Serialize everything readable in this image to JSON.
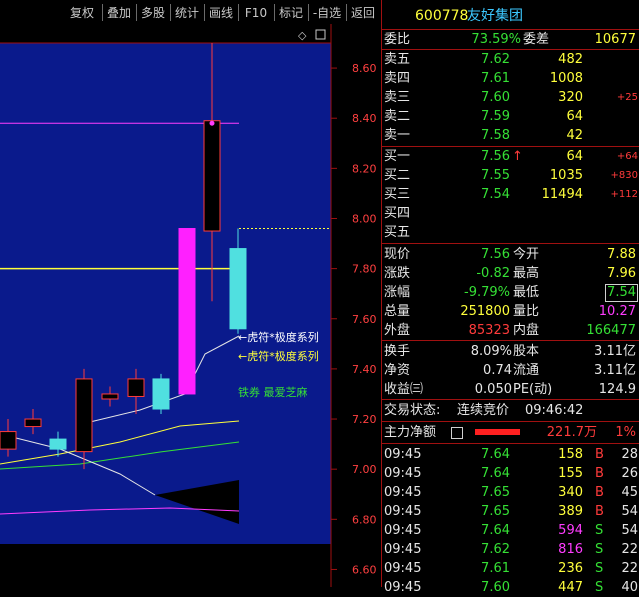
{
  "toolbar": {
    "items": [
      "复权",
      "叠加",
      "多股",
      "统计",
      "画线",
      "F10",
      "标记",
      "-自选",
      "返回"
    ]
  },
  "header": {
    "code": "600778",
    "name": "友好集团"
  },
  "weibi": {
    "label": "委比",
    "value": "73.59%",
    "diff_label": "委差",
    "diff_value": "10677"
  },
  "sell": [
    {
      "label": "卖五",
      "price": "7.62",
      "vol": "482",
      "chg": ""
    },
    {
      "label": "卖四",
      "price": "7.61",
      "vol": "1008",
      "chg": ""
    },
    {
      "label": "卖三",
      "price": "7.60",
      "vol": "320",
      "chg": "+25"
    },
    {
      "label": "卖二",
      "price": "7.59",
      "vol": "64",
      "chg": ""
    },
    {
      "label": "卖一",
      "price": "7.58",
      "vol": "42",
      "chg": ""
    }
  ],
  "buy": [
    {
      "label": "买一",
      "price": "7.56",
      "vol": "64",
      "chg": "+64",
      "arrow": "↑"
    },
    {
      "label": "买二",
      "price": "7.55",
      "vol": "1035",
      "chg": "+830",
      "arrow": ""
    },
    {
      "label": "买三",
      "price": "7.54",
      "vol": "11494",
      "chg": "+112",
      "arrow": ""
    },
    {
      "label": "买四",
      "price": "",
      "vol": "",
      "chg": "",
      "arrow": ""
    },
    {
      "label": "买五",
      "price": "",
      "vol": "",
      "chg": "",
      "arrow": ""
    }
  ],
  "quote": {
    "xianjia_label": "现价",
    "xianjia": "7.56",
    "jinkai_label": "今开",
    "jinkai": "7.88",
    "zhangdie_label": "涨跌",
    "zhangdie": "-0.82",
    "zuigao_label": "最高",
    "zuigao": "7.96",
    "zhangfu_label": "涨幅",
    "zhangfu": "-9.79%",
    "zuidi_label": "最低",
    "zuidi": "7.54",
    "zongliang_label": "总量",
    "zongliang": "251800",
    "liangbi_label": "量比",
    "liangbi": "10.27",
    "waipan_label": "外盘",
    "waipan": "85323",
    "neipan_label": "内盘",
    "neipan": "166477"
  },
  "stats": {
    "huanshou_label": "换手",
    "huanshou": "8.09%",
    "guben_label": "股本",
    "guben": "3.11亿",
    "jingzi_label": "净资",
    "jingzi": "0.74",
    "liutong_label": "流通",
    "liutong": "3.11亿",
    "shouyi_label": "收益㈢",
    "shouyi": "0.050",
    "pe_label": "PE(动)",
    "pe": "124.9"
  },
  "status": {
    "label": "交易状态:",
    "value": "连续竞价",
    "time": "09:46:42"
  },
  "main_force": {
    "label": "主力净额",
    "value": "221.7万",
    "pct": "1%",
    "bar_fraction": 0.9
  },
  "ticks": [
    {
      "time": "09:45",
      "price": "7.64",
      "vol": "158",
      "bs": "B",
      "n": "28"
    },
    {
      "time": "09:45",
      "price": "7.64",
      "vol": "155",
      "bs": "B",
      "n": "26"
    },
    {
      "time": "09:45",
      "price": "7.65",
      "vol": "340",
      "bs": "B",
      "n": "45"
    },
    {
      "time": "09:45",
      "price": "7.65",
      "vol": "389",
      "bs": "B",
      "n": "54"
    },
    {
      "time": "09:45",
      "price": "7.64",
      "vol": "594",
      "bs": "S",
      "n": "54"
    },
    {
      "time": "09:45",
      "price": "7.62",
      "vol": "816",
      "bs": "S",
      "n": "22"
    },
    {
      "time": "09:45",
      "price": "7.61",
      "vol": "236",
      "bs": "S",
      "n": "22"
    },
    {
      "time": "09:45",
      "price": "7.60",
      "vol": "447",
      "bs": "S",
      "n": "40"
    }
  ],
  "chart_data": {
    "type": "candlestick",
    "y_ticks": [
      "8.60",
      "8.40",
      "8.20",
      "8.00",
      "7.80",
      "7.60",
      "7.40",
      "7.20",
      "7.00",
      "6.80",
      "6.60"
    ],
    "ylim": [
      6.53,
      8.7
    ],
    "candles": [
      {
        "o": 7.08,
        "c": 7.15,
        "h": 7.2,
        "l": 7.05
      },
      {
        "o": 7.17,
        "c": 7.2,
        "h": 7.24,
        "l": 7.14
      },
      {
        "o": 7.12,
        "c": 7.08,
        "h": 7.15,
        "l": 7.05
      },
      {
        "o": 7.07,
        "c": 7.36,
        "h": 7.4,
        "l": 7.0
      },
      {
        "o": 7.28,
        "c": 7.3,
        "h": 7.33,
        "l": 7.25
      },
      {
        "o": 7.29,
        "c": 7.36,
        "h": 7.4,
        "l": 7.22
      },
      {
        "o": 7.36,
        "c": 7.24,
        "h": 7.38,
        "l": 7.22
      },
      {
        "o": 7.3,
        "c": 7.96,
        "h": 7.96,
        "l": 7.3
      },
      {
        "o": 7.95,
        "c": 8.39,
        "h": 8.7,
        "l": 7.67
      },
      {
        "o": 7.88,
        "c": 7.56,
        "h": 7.96,
        "l": 7.54
      }
    ],
    "annotations": [
      "←虎符*极度系列",
      "←虎符*极度系列",
      "铁券 最爱芝麻"
    ],
    "levels": {
      "limit_up": 8.38,
      "prev_close": 7.8,
      "current_dashed": 7.96
    }
  }
}
